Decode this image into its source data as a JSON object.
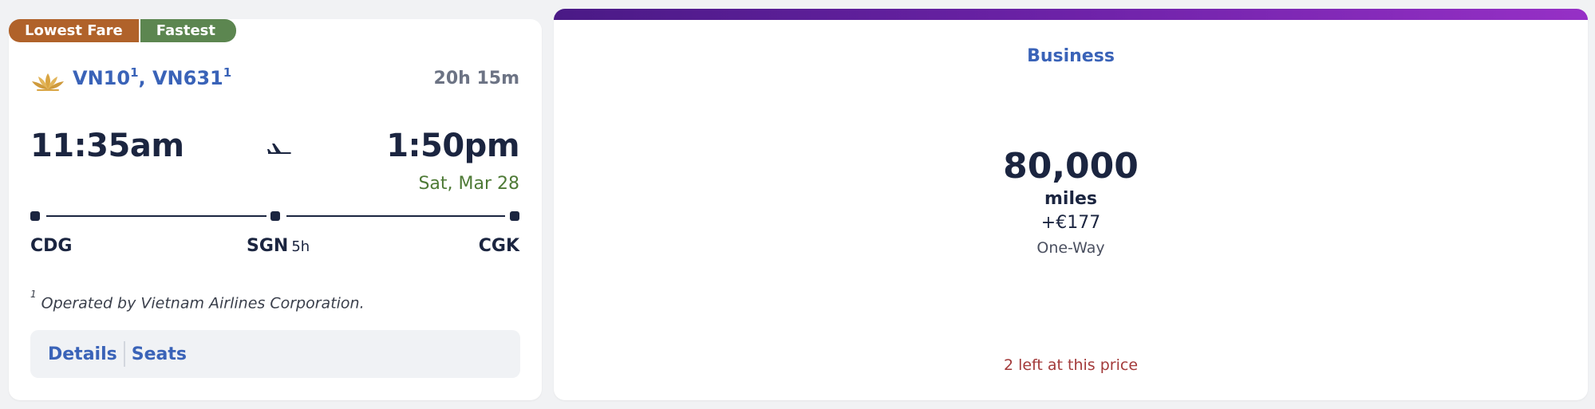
{
  "badges": {
    "lowest": "Lowest Fare",
    "fastest": "Fastest"
  },
  "flight": {
    "numbers": [
      {
        "code": "VN10",
        "note": "1"
      },
      {
        "code": "VN631",
        "note": "1"
      }
    ],
    "separator": ", ",
    "duration": "20h 15m",
    "departure_time": "11:35am",
    "arrival_time": "1:50pm",
    "arrival_date": "Sat, Mar 28",
    "origin": "CDG",
    "stop": "SGN",
    "layover": "5h",
    "destination": "CGK",
    "footnote_mark": "1",
    "footnote": "Operated by Vietnam Airlines Corporation."
  },
  "actions": {
    "details": "Details",
    "seats": "Seats"
  },
  "fare": {
    "cabin": "Business",
    "miles": "80,000",
    "miles_unit": "miles",
    "fee": "+€177",
    "trip_type": "One-Way",
    "availability": "2 left at this price"
  },
  "colors": {
    "accent_gradient_start": "#4a1a86",
    "accent_gradient_end": "#9630c6",
    "lowest_fare_badge": "#b0622a",
    "fastest_badge": "#5c8650",
    "link_blue": "#3a63b8"
  },
  "icons": {
    "airline": "lotus-logo-icon",
    "plane": "plane-icon"
  }
}
